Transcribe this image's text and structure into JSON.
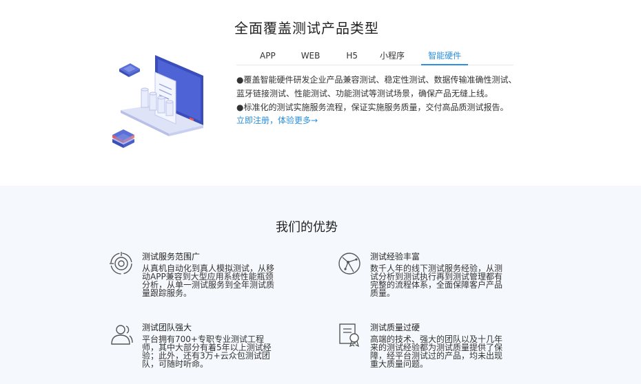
{
  "products": {
    "title": "全面覆盖测试产品类型",
    "tabs": [
      {
        "label": "APP"
      },
      {
        "label": "WEB"
      },
      {
        "label": "H5"
      },
      {
        "label": "小程序"
      },
      {
        "label": "智能硬件"
      }
    ],
    "active_tab": "智能硬件",
    "description": [
      "●覆盖智能硬件研发企业产品兼容测试、稳定性测试、数据传输准确性测试、蓝牙链接测试、性能测试、功能测试等测试场景，确保产品无缝上线。",
      "●标准化的测试实施服务流程，保证实施服务质量，交付高品质测试报告。"
    ],
    "cta": "立即注册，体验更多→",
    "illustration_icon": "laptop-with-servers-illustration"
  },
  "advantages": {
    "title": "我们的优势",
    "items": [
      {
        "icon": "target-icon",
        "title": "测试服务范围广",
        "text": "从真机自动化到真人模拟测试，从移动APP兼容到大型应用系统性能瓶颈分析，从单一测试服务到全年测试质量跟踪服务。"
      },
      {
        "icon": "globe-icon",
        "title": "测试经验丰富",
        "text": "数千人年的线下测试服务经验，从测试分析到测试执行再到测试管理都有完整的流程体系，全面保障客户产品质量。"
      },
      {
        "icon": "team-icon",
        "title": "测试团队强大",
        "text": "平台拥有700+专职专业测试工程师，其中大部分有着5年以上测试经验；此外，还有3万+云众包测试团队，可随时听命。"
      },
      {
        "icon": "certificate-icon",
        "title": "测试质量过硬",
        "text": "高端的技术、强大的团队以及十几年来的测试经验都为测试质量提供了保障，经平台测试过的产品，均未出现重大质量问题。"
      }
    ]
  },
  "colors": {
    "accent": "#2a8fe0",
    "section_bg": "#f5f8fc"
  }
}
